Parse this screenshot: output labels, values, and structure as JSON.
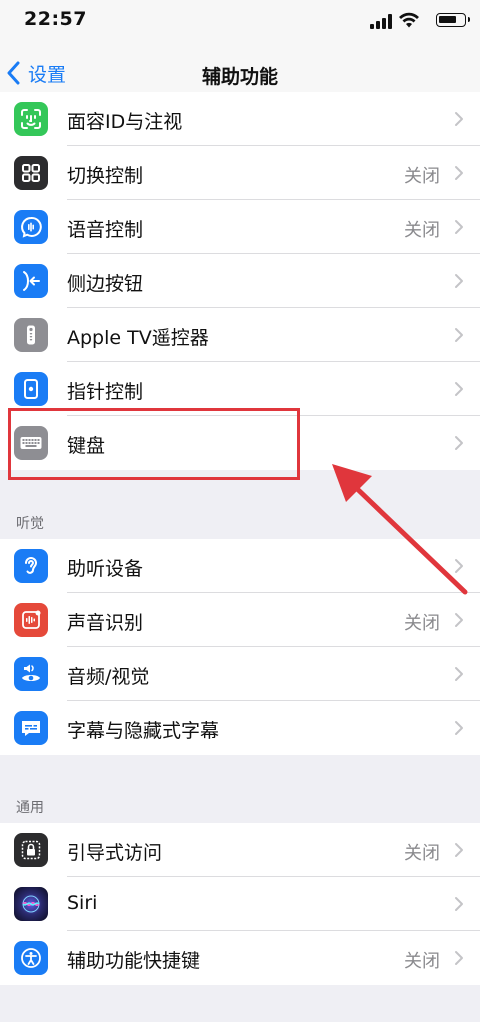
{
  "status_bar": {
    "time": "22:57"
  },
  "nav": {
    "back_label": "设置",
    "title": "辅助功能"
  },
  "groups": {
    "physical": {
      "items": [
        {
          "label": "面容ID与注视",
          "value": "",
          "icon": "face-id-icon",
          "color": "#34c759"
        },
        {
          "label": "切换控制",
          "value": "关闭",
          "icon": "switch-control-icon",
          "color": "#2c2c2e"
        },
        {
          "label": "语音控制",
          "value": "关闭",
          "icon": "voice-control-icon",
          "color": "#1a7cf5"
        },
        {
          "label": "侧边按钮",
          "value": "",
          "icon": "side-button-icon",
          "color": "#1a7cf5"
        },
        {
          "label": "Apple TV遥控器",
          "value": "",
          "icon": "apple-tv-remote-icon",
          "color": "#8e8e93"
        },
        {
          "label": "指针控制",
          "value": "",
          "icon": "pointer-control-icon",
          "color": "#1a7cf5"
        },
        {
          "label": "键盘",
          "value": "",
          "icon": "keyboard-icon",
          "color": "#8e8e93"
        }
      ]
    },
    "hearing": {
      "header": "听觉",
      "items": [
        {
          "label": "助听设备",
          "value": "",
          "icon": "hearing-devices-icon",
          "color": "#1a7cf5"
        },
        {
          "label": "声音识别",
          "value": "关闭",
          "icon": "sound-recognition-icon",
          "color": "#e5493a"
        },
        {
          "label": "音频/视觉",
          "value": "",
          "icon": "audio-visual-icon",
          "color": "#1a7cf5"
        },
        {
          "label": "字幕与隐藏式字幕",
          "value": "",
          "icon": "subtitles-icon",
          "color": "#1a7cf5"
        }
      ]
    },
    "general": {
      "header": "通用",
      "items": [
        {
          "label": "引导式访问",
          "value": "关闭",
          "icon": "guided-access-icon",
          "color": "#2c2c2e"
        },
        {
          "label": "Siri",
          "value": "",
          "icon": "siri-icon",
          "color": "#1c1c3a"
        },
        {
          "label": "辅助功能快捷键",
          "value": "关闭",
          "icon": "accessibility-shortcut-icon",
          "color": "#1a7cf5"
        }
      ]
    }
  },
  "annotation": {
    "highlight_color": "#e0363c"
  }
}
